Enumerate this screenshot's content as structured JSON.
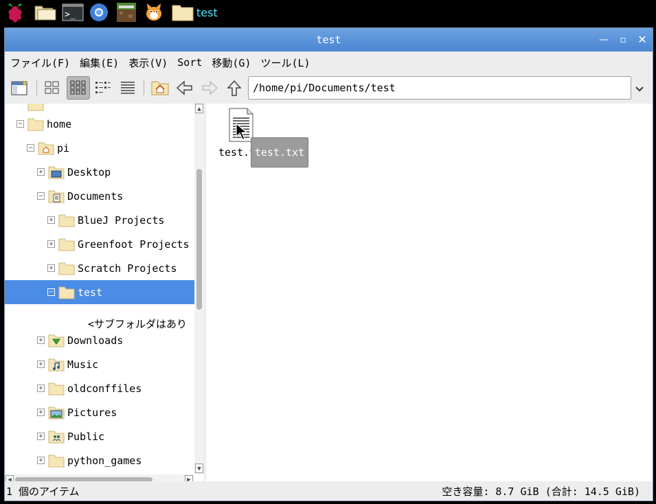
{
  "taskbar": {
    "task_label": "test"
  },
  "window": {
    "title": "test",
    "minimize_symbol": "—",
    "maximize_symbol": "▫",
    "close_symbol": "✕"
  },
  "menubar": [
    "ファイル(F)",
    "編集(E)",
    "表示(V)",
    "Sort",
    "移動(G)",
    "ツール(L)"
  ],
  "toolbar": {
    "path": "/home/pi/Documents/test"
  },
  "tree": {
    "rows": [
      {
        "label": "home",
        "expander": "−"
      },
      {
        "label": "pi",
        "expander": "−"
      },
      {
        "label": "Desktop",
        "expander": "+"
      },
      {
        "label": "Documents",
        "expander": "−"
      },
      {
        "label": "BlueJ Projects",
        "expander": "+"
      },
      {
        "label": "Greenfoot Projects",
        "expander": "+"
      },
      {
        "label": "Scratch Projects",
        "expander": "+"
      },
      {
        "label": "test",
        "expander": "−"
      },
      {
        "label": "Downloads",
        "expander": "+"
      },
      {
        "label": "Music",
        "expander": "+"
      },
      {
        "label": "oldconffiles",
        "expander": "+"
      },
      {
        "label": "Pictures",
        "expander": "+"
      },
      {
        "label": "Public",
        "expander": "+"
      },
      {
        "label": "python_games",
        "expander": "+"
      }
    ],
    "empty_note": "<サブフォルダはあり"
  },
  "main": {
    "file_label": "test.t",
    "tooltip": "test.txt"
  },
  "status": {
    "items": "1 個のアイテム",
    "free_space": "空き容量: 8.7 GiB (合計: 14.5 GiB)"
  },
  "colors": {
    "titlebar": "#5b94da",
    "selection": "#4a8ce6",
    "taskbar_text": "#4fe3ff",
    "folder": "#f7e6b5"
  }
}
